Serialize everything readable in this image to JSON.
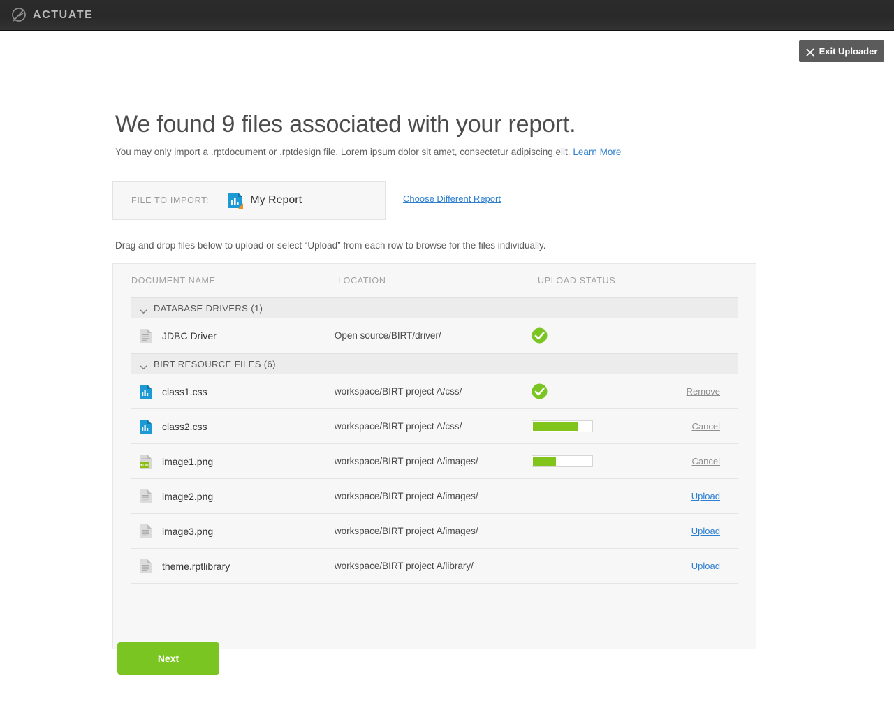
{
  "topbar": {
    "brand": "ACTUATE",
    "logo_icon": "actuate-swoosh-logo"
  },
  "exit": {
    "label": "Exit Uploader",
    "icon": "close-x-icon"
  },
  "page": {
    "headline": "We found 9 files associated with your report.",
    "subline": "You may only import a .rptdocument or .rptdesign file. Lorem ipsum dolor sit amet, consectetur adipiscing elit.",
    "learn_more": "Learn More",
    "dragdrop": "Drag and drop files below to upload or select “Upload” from each row to browse for the files individually."
  },
  "import": {
    "label": "FILE TO IMPORT:",
    "file_name": "My Report",
    "file_icon": "report-chart-document-icon",
    "choose_different": "Choose Different Report"
  },
  "table": {
    "headers": {
      "name": "DOCUMENT NAME",
      "location": "LOCATION",
      "status": "UPLOAD STATUS"
    },
    "groups": [
      {
        "title": "DATABASE DRIVERS (1)",
        "chevron": "chevron-down-icon",
        "rows": [
          {
            "name": "JDBC Driver",
            "location": "Open source/BIRT/driver/",
            "icon": "generic-document-icon",
            "status_type": "complete",
            "status_icon": "green-check-icon",
            "progress": null,
            "action": null,
            "action_style": null
          }
        ]
      },
      {
        "title": "BIRT RESOURCE FILES (6)",
        "chevron": "chevron-down-icon",
        "rows": [
          {
            "name": "class1.css",
            "location": "workspace/BIRT project A/css/",
            "icon": "blue-chart-document-icon",
            "status_type": "complete",
            "status_icon": "green-check-icon",
            "progress": null,
            "action": "Remove",
            "action_style": "gray"
          },
          {
            "name": "class2.css",
            "location": "workspace/BIRT project A/css/",
            "icon": "blue-chart-document-icon",
            "status_type": "progress",
            "status_icon": "progress-bar",
            "progress": 78,
            "action": "Cancel",
            "action_style": "gray"
          },
          {
            "name": "image1.png",
            "location": "workspace/BIRT project A/images/",
            "icon": "html-badge-document-icon",
            "status_type": "progress",
            "status_icon": "progress-bar",
            "progress": 40,
            "action": "Cancel",
            "action_style": "gray"
          },
          {
            "name": "image2.png",
            "location": "workspace/BIRT project A/images/",
            "icon": "generic-document-icon",
            "status_type": "none",
            "status_icon": null,
            "progress": null,
            "action": "Upload",
            "action_style": "blue"
          },
          {
            "name": "image3.png",
            "location": "workspace/BIRT project A/images/",
            "icon": "generic-document-icon",
            "status_type": "none",
            "status_icon": null,
            "progress": null,
            "action": "Upload",
            "action_style": "blue"
          },
          {
            "name": "theme.rptlibrary",
            "location": "workspace/BIRT project A/library/",
            "icon": "generic-document-icon",
            "status_type": "none",
            "status_icon": null,
            "progress": null,
            "action": "Upload",
            "action_style": "blue"
          }
        ]
      }
    ]
  },
  "footer": {
    "next_label": "Next"
  },
  "colors": {
    "accent_green": "#7ac521",
    "progress_green": "#80c41c",
    "link_blue": "#2f7fd0",
    "topbar_dark": "#2b2b2b",
    "panel_bg": "#f7f7f7",
    "group_bg": "#ececec"
  }
}
